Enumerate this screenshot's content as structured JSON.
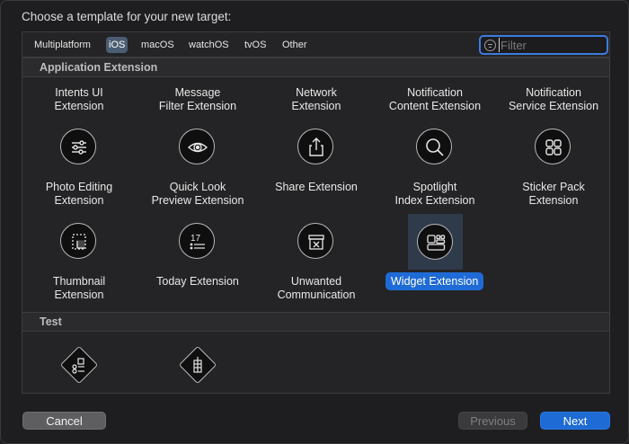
{
  "dialog": {
    "prompt": "Choose a template for your new target:"
  },
  "platform_tabs": [
    {
      "label": "Multiplatform",
      "active": false
    },
    {
      "label": "iOS",
      "active": true
    },
    {
      "label": "macOS",
      "active": false
    },
    {
      "label": "watchOS",
      "active": false
    },
    {
      "label": "tvOS",
      "active": false
    },
    {
      "label": "Other",
      "active": false
    }
  ],
  "filter": {
    "placeholder": "Filter",
    "value": ""
  },
  "sections": [
    {
      "title": "Application Extension"
    },
    {
      "title": "Test"
    }
  ],
  "templates": [
    {
      "line1": "Intents UI",
      "line2": "Extension",
      "icon": "sliders-icon"
    },
    {
      "line1": "Message",
      "line2": "Filter Extension",
      "icon": "eye-icon"
    },
    {
      "line1": "Network",
      "line2": "Extension",
      "icon": "share-box-icon"
    },
    {
      "line1": "Notification",
      "line2": "Content Extension",
      "icon": "magnifier-icon"
    },
    {
      "line1": "Notification",
      "line2": "Service Extension",
      "icon": "four-squares-icon"
    },
    {
      "line1": "Photo Editing",
      "line2": "Extension",
      "icon": "crop-frame-icon"
    },
    {
      "line1": "Quick Look",
      "line2": "Preview Extension",
      "icon": "calendar-list-icon"
    },
    {
      "line1": "Share Extension",
      "line2": "",
      "icon": "archive-x-icon"
    },
    {
      "line1": "Spotlight",
      "line2": "Index Extension",
      "icon": "widget-grid-icon"
    },
    {
      "line1": "Sticker Pack",
      "line2": "Extension",
      "icon": ""
    },
    {
      "line1": "Thumbnail",
      "line2": "Extension",
      "icon": ""
    },
    {
      "line1": "Today Extension",
      "line2": "",
      "icon": ""
    },
    {
      "line1": "Unwanted",
      "line2": "Communication",
      "icon": ""
    },
    {
      "line1": "Widget Extension",
      "line2": "",
      "icon": "",
      "selected": true
    }
  ],
  "icon_calendar_number": "17",
  "test_templates": [
    {
      "icon": "ui-test-diamond-icon"
    },
    {
      "icon": "unit-test-diamond-icon"
    }
  ],
  "buttons": {
    "cancel": "Cancel",
    "previous": "Previous",
    "next": "Next"
  },
  "colors": {
    "accent": "#1f6bd6",
    "selection_bg": "#2f3a4a"
  }
}
